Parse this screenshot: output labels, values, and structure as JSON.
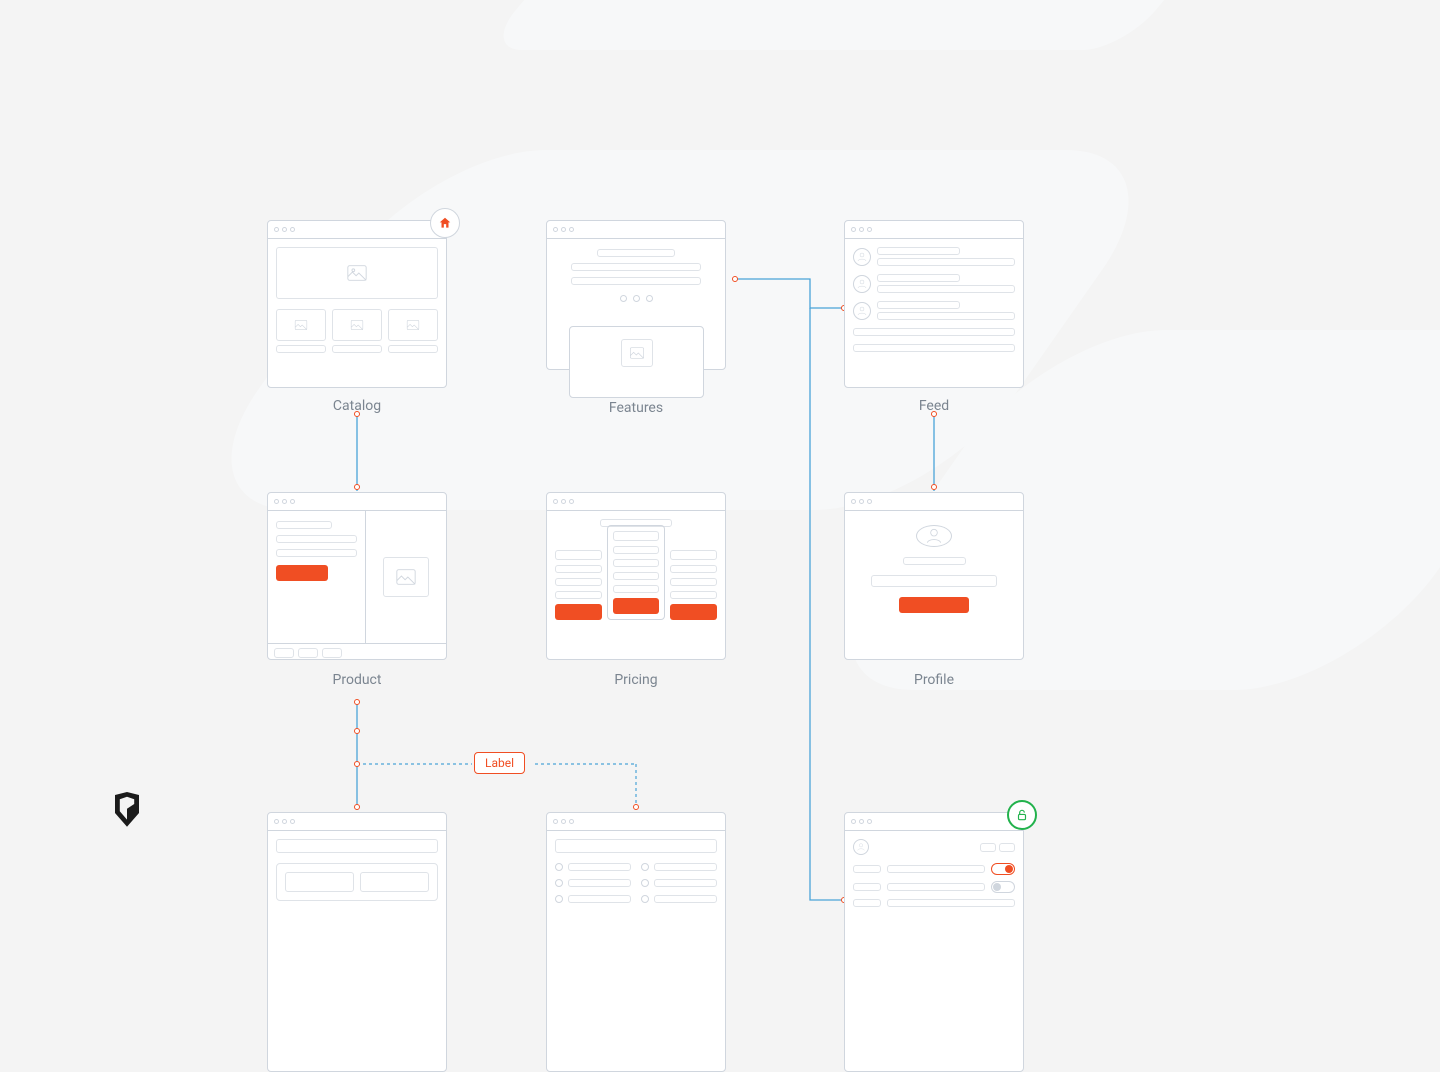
{
  "cards": {
    "catalog": {
      "caption": "Catalog"
    },
    "features": {
      "caption": "Features"
    },
    "feed": {
      "caption": "Feed"
    },
    "product": {
      "caption": "Product"
    },
    "pricing": {
      "caption": "Pricing"
    },
    "profile": {
      "caption": "Profile"
    }
  },
  "connector_label": "Label",
  "badges": {
    "home": "home-icon",
    "lock": "lock-open-icon"
  },
  "colors": {
    "accent": "#f04e23",
    "success": "#22b24c",
    "link": "#4aa3d8",
    "outline": "#d0d6de"
  }
}
